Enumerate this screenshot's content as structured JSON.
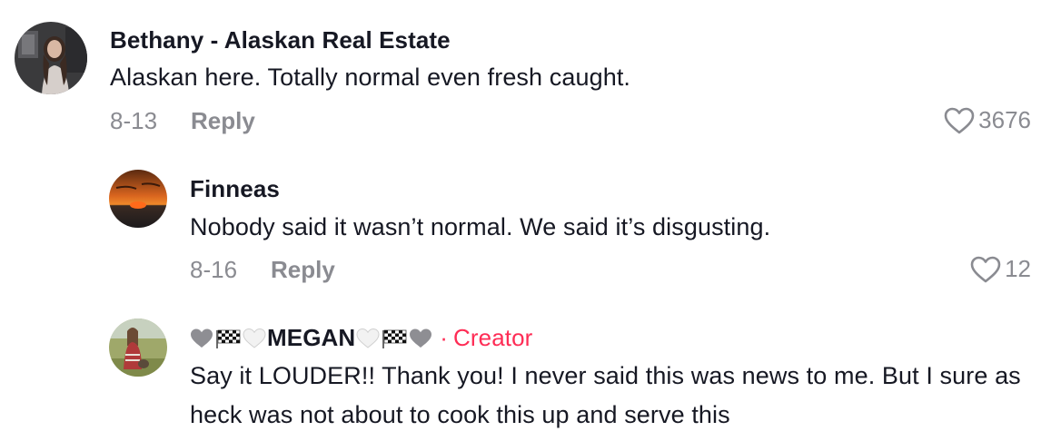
{
  "comments": [
    {
      "username": "Bethany - Alaskan Real Estate",
      "text": "Alaskan here. Totally normal even fresh caught.",
      "date": "8-13",
      "reply_label": "Reply",
      "likes": "3676"
    },
    {
      "username": "Finneas",
      "text": "Nobody said it wasn’t normal. We said it’s disgusting.",
      "date": "8-16",
      "reply_label": "Reply",
      "likes": "12"
    },
    {
      "username": "MEGAN",
      "badge_separator": "·",
      "badge": "Creator",
      "text": "Say it LOUDER!! Thank you! I never said this was news to me. But I sure as heck was not about to cook this up and serve this"
    }
  ],
  "colors": {
    "text": "#161823",
    "meta": "#8a8b91",
    "creator": "#fe2c55"
  }
}
